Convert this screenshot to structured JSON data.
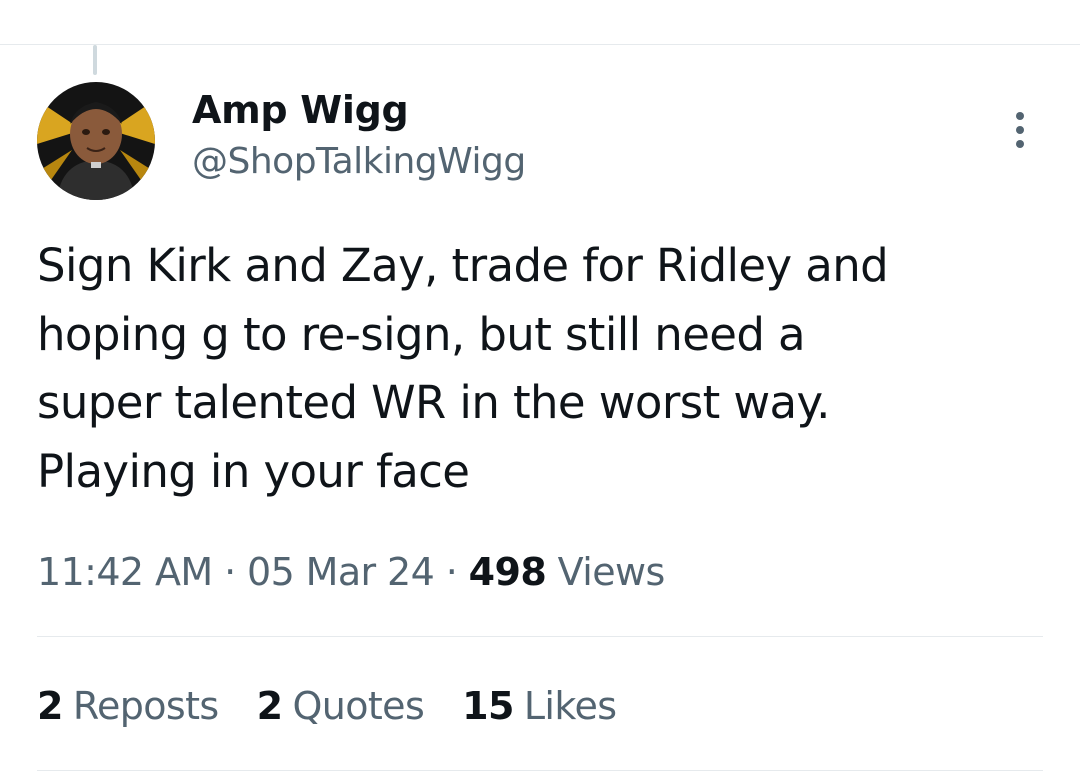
{
  "tweet": {
    "author": {
      "display_name": "Amp Wigg",
      "handle": "@ShopTalkingWigg"
    },
    "text_lines": [
      "Sign Kirk and Zay, trade for Ridley and",
      "hoping g to re-sign, but still need a",
      "super talented WR in the worst way.",
      "Playing in your face"
    ],
    "meta": {
      "time": "11:42 AM",
      "separator": "·",
      "date": "05 Mar 24",
      "views_count": "498",
      "views_label": "Views"
    },
    "stats": {
      "reposts": {
        "count": "2",
        "label": "Reposts"
      },
      "quotes": {
        "count": "2",
        "label": "Quotes"
      },
      "likes": {
        "count": "15",
        "label": "Likes"
      }
    },
    "icons": {
      "more": "more-vertical-icon"
    }
  },
  "colors": {
    "text_primary": "#0f1419",
    "text_secondary": "#536471",
    "divider": "#e6eaed"
  }
}
